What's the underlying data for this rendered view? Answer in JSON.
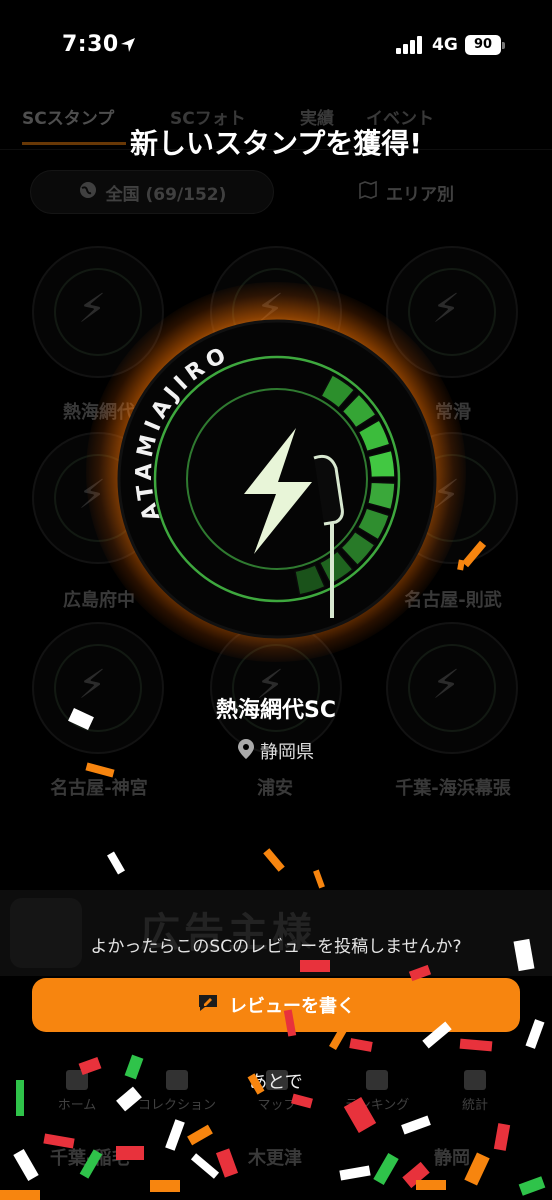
{
  "status_bar": {
    "time": "7:30",
    "network": "4G",
    "battery": "90"
  },
  "background": {
    "tabs": [
      "SCスタンプ",
      "SCフォト",
      "実績",
      "イベント"
    ],
    "filter_all": "全国 (69/152)",
    "filter_area": "エリア別",
    "stamp_labels": [
      "熱海網代",
      "常滑",
      "広島府中",
      "名古屋-則武",
      "名古屋-神宮",
      "浦安",
      "千葉-海浜幕張"
    ],
    "ad_text": "広告主様",
    "nav": [
      "ホーム",
      "コレクション",
      "マップ",
      "ランキング",
      "統計"
    ],
    "bottom_labels": [
      "千葉-稲毛",
      "木更津",
      "静岡"
    ]
  },
  "modal": {
    "title": "新しいスタンプを獲得!",
    "badge_text": "ATAMIAJIRO",
    "sc_name": "熱海網代SC",
    "prefecture": "静岡県",
    "review_prompt": "よかったらこのSCのレビューを投稿しませんか?",
    "review_button": "レビューを書く",
    "later": "あとで"
  },
  "colors": {
    "accent": "#f7850f",
    "badge_green": "#38c83a",
    "bg": "#000000"
  },
  "icons": {
    "location": "location-arrow-icon",
    "pin": "map-pin-icon",
    "review": "review-pencil-icon"
  }
}
